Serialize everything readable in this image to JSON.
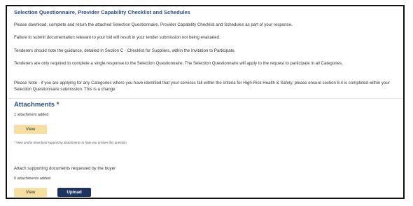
{
  "questionnaire": {
    "title": "Selection Questionnaire, Provider Capability Checklist and Schedules",
    "paragraphs": [
      "Please download, complete and return the attached Selection Questionnaire, Provider Capability Checklist and Schedules as part of your response.",
      "Failure to submit documentation relevant to your bid will result in your tender submission not being evaluated.",
      "Tenderers should note the guidance, detailed in Section C - Checklist for Suppliers, within the Invitation to Participate.",
      "Tenderers are only required to complete a single response to the Selection Questionnaire. The Selection Questionnaire will apply to the request to participate in all Categories.",
      "Please Note - if you are applying for any Categories where you have identified that your services fall within the criteria for High-Risk Health & Safety, please ensure section 8.4 is completed within your Selection Questionnaire submission. This is a change"
    ]
  },
  "attachments": {
    "title": "Attachments *",
    "count_text": "1 attachment added",
    "view_label": "View",
    "help_text": "* View and/or download supporting attachments to help you answer this question"
  },
  "buyer_docs": {
    "label": "Attach supporting documents requested by the buyer",
    "count_text": "0 attachments added",
    "view_label": "View",
    "upload_label": "Upload"
  },
  "colors": {
    "heading": "#2b4f86",
    "view_button": "#f7dfa2",
    "upload_button": "#1e3460"
  }
}
